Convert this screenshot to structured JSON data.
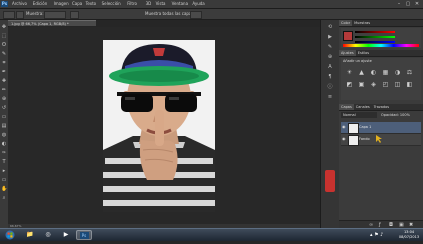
{
  "app": {
    "logo_text": "Ps",
    "menu": [
      "Archivo",
      "Edición",
      "Imagen",
      "Capa",
      "Texto",
      "Selección",
      "Filtro",
      "3D",
      "Vista",
      "Ventana",
      "Ayuda"
    ],
    "window_controls": [
      "–",
      "▢",
      "✕"
    ]
  },
  "options_bar": {
    "label_1": "Muestra:",
    "label_2": "Muestra todas las capas"
  },
  "document": {
    "tab_title": "1.jpg @ 66,7% (Capa 1, RGB/8) *",
    "status": "66,67%"
  },
  "tools": [
    {
      "name": "move-tool-icon",
      "glyph": "✥"
    },
    {
      "name": "marquee-tool-icon",
      "glyph": "⬚"
    },
    {
      "name": "lasso-tool-icon",
      "glyph": "ʘ"
    },
    {
      "name": "quick-select-tool-icon",
      "glyph": "✎"
    },
    {
      "name": "crop-tool-icon",
      "glyph": "⌗"
    },
    {
      "name": "eyedropper-tool-icon",
      "glyph": "✒"
    },
    {
      "name": "healing-tool-icon",
      "glyph": "✚"
    },
    {
      "name": "brush-tool-icon",
      "glyph": "✏"
    },
    {
      "name": "clone-tool-icon",
      "glyph": "⊕"
    },
    {
      "name": "history-brush-icon",
      "glyph": "↺"
    },
    {
      "name": "eraser-tool-icon",
      "glyph": "▭"
    },
    {
      "name": "gradient-tool-icon",
      "glyph": "▤"
    },
    {
      "name": "blur-tool-icon",
      "glyph": "◍"
    },
    {
      "name": "dodge-tool-icon",
      "glyph": "◐"
    },
    {
      "name": "pen-tool-icon",
      "glyph": "✑"
    },
    {
      "name": "type-tool-icon",
      "glyph": "T"
    },
    {
      "name": "path-select-tool-icon",
      "glyph": "▸"
    },
    {
      "name": "shape-tool-icon",
      "glyph": "▭"
    },
    {
      "name": "hand-tool-icon",
      "glyph": "✋"
    },
    {
      "name": "zoom-tool-icon",
      "glyph": "⌕"
    }
  ],
  "panels": {
    "color_tabs": [
      "Color",
      "Muestras"
    ],
    "adjust_tabs": [
      "Ajustes",
      "Estilos"
    ],
    "adjust_title": "Añadir un ajuste",
    "layers_tabs": [
      "Capas",
      "Canales",
      "Trazados"
    ],
    "blend_mode": "Normal",
    "opacity_label": "Opacidad: 100%",
    "layers": [
      {
        "name": "Capa 1",
        "selected": true
      },
      {
        "name": "Fondo",
        "selected": false
      }
    ]
  },
  "taskbar": {
    "clock_time": "13:04",
    "clock_date": "08/07/2013"
  },
  "colors": {
    "accent_selection": "#4d5f7a",
    "hat_green": "#1fa35a"
  }
}
